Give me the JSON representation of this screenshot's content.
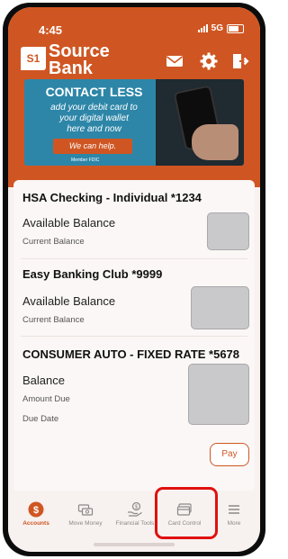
{
  "status": {
    "time": "4:45",
    "network": "5G"
  },
  "brand": {
    "logo_mark": "S1",
    "line1": "Source",
    "line2": "Bank",
    "color": "#cf5622"
  },
  "header_icons": [
    "envelope-icon",
    "gear-icon",
    "logout-icon"
  ],
  "banner": {
    "title": "CONTACT LESS",
    "line1": "add your debit card to",
    "line2": "your digital wallet",
    "line3": "here and now",
    "button": "We can help.",
    "fine_print": "Member FDIC"
  },
  "accounts": [
    {
      "title": "HSA Checking - Individual *1234",
      "label1": "Available Balance",
      "label2": "Current Balance"
    },
    {
      "title": "Easy Banking Club *9999",
      "label1": "Available Balance",
      "label2": "Current Balance"
    },
    {
      "title": "CONSUMER AUTO - FIXED RATE *5678",
      "label1": "Balance",
      "label2": "Amount Due",
      "label3": "Due Date",
      "action": "Pay"
    }
  ],
  "tabs": [
    {
      "label": "Accounts",
      "icon": "dollar-icon",
      "active": true
    },
    {
      "label": "Move Money",
      "icon": "transfer-icon",
      "active": false
    },
    {
      "label": "Financial Tools",
      "icon": "hand-dollar-icon",
      "active": false
    },
    {
      "label": "Card Control",
      "icon": "card-icon",
      "active": false
    },
    {
      "label": "More",
      "icon": "menu-icon",
      "active": false
    }
  ],
  "highlight_color": "#e0100f"
}
